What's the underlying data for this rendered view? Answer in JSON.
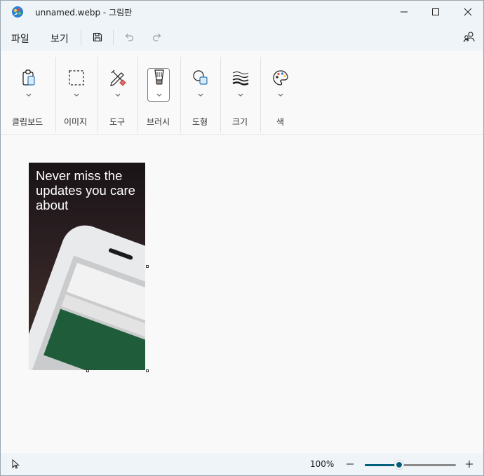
{
  "window": {
    "title": "unnamed.webp - 그림판"
  },
  "menu": {
    "file": "파일",
    "view": "보기"
  },
  "ribbon": {
    "groups": [
      {
        "label": "클립보드",
        "icon": "clipboard-icon"
      },
      {
        "label": "이미지",
        "icon": "selection-icon"
      },
      {
        "label": "도구",
        "icon": "tools-icon"
      },
      {
        "label": "브러시",
        "icon": "brush-icon"
      },
      {
        "label": "도형",
        "icon": "shapes-icon"
      },
      {
        "label": "크기",
        "icon": "size-icon"
      },
      {
        "label": "색",
        "icon": "palette-icon"
      }
    ]
  },
  "canvas": {
    "image_text": {
      "headline": "Never miss the updates you care about"
    }
  },
  "status": {
    "zoom": "100%",
    "zoom_level": 0.38
  },
  "colors": {
    "accent": "#005f7d",
    "titlebar_bg": "#eef4f7"
  }
}
